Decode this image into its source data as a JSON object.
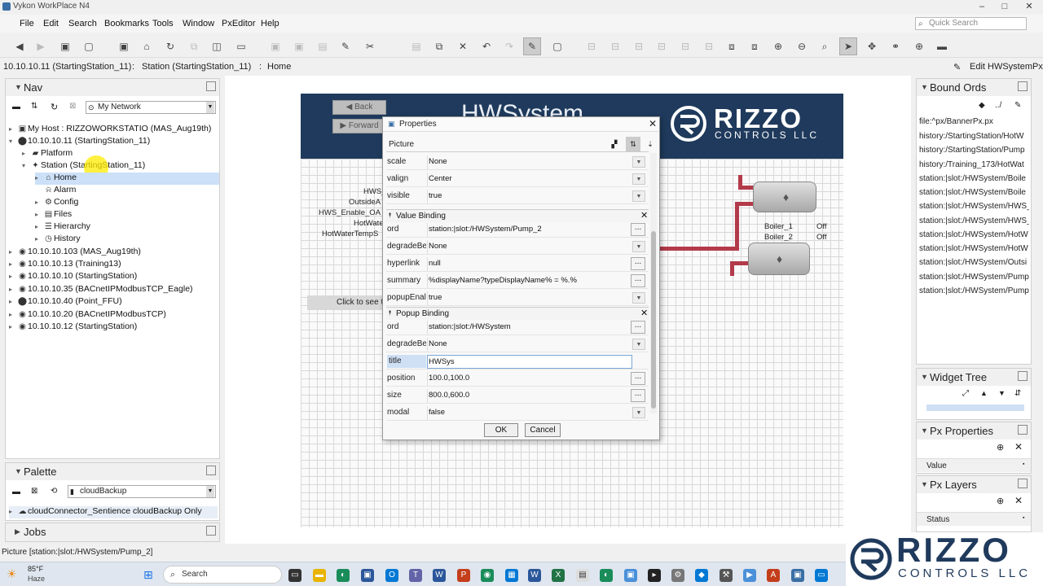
{
  "window": {
    "title": "Vykon WorkPlace N4",
    "minimize": "–",
    "maximize": "□",
    "close": "✕"
  },
  "menu": [
    "File",
    "Edit",
    "Search",
    "Bookmarks",
    "Tools",
    "Window",
    "PxEditor",
    "Help"
  ],
  "quick_search": {
    "placeholder": "Quick Search"
  },
  "breadcrumb": [
    "10.10.10.11 (StartingStation_11)",
    "Station (StartingStation_11)",
    "Home"
  ],
  "edit_label": "Edit HWSystemPx",
  "nav": {
    "title": "Nav",
    "network_select": "My Network",
    "tree": [
      {
        "label": "My Host : RIZZOWORKSTATIO (MAS_Aug19th)"
      },
      {
        "label": "10.10.10.11 (StartingStation_11)"
      },
      {
        "label": "Platform"
      },
      {
        "label": "Station (StartingStation_11)"
      },
      {
        "label": "Home"
      },
      {
        "label": "Alarm"
      },
      {
        "label": "Config"
      },
      {
        "label": "Files"
      },
      {
        "label": "Hierarchy"
      },
      {
        "label": "History"
      },
      {
        "label": "10.10.10.103 (MAS_Aug19th)"
      },
      {
        "label": "10.10.10.13 (Training13)"
      },
      {
        "label": "10.10.10.10 (StartingStation)"
      },
      {
        "label": "10.10.10.35 (BACnetIPModbusTCP_Eagle)"
      },
      {
        "label": "10.10.10.40 (Point_FFU)"
      },
      {
        "label": "10.10.10.20 (BACnetIPModbusTCP)"
      },
      {
        "label": "10.10.10.12 (StartingStation)"
      }
    ]
  },
  "palette": {
    "title": "Palette",
    "select": "cloudBackup",
    "item": "cloudConnector_Sentience cloudBackup Only"
  },
  "jobs": {
    "title": "Jobs"
  },
  "status_bar": "Picture [station:|slot:/HWSystem/Pump_2]",
  "canvas": {
    "header_title": "HWSystem",
    "back": "Back",
    "forward": "Forward",
    "logo_main": "RIZZO",
    "logo_sub": "CONTROLS LLC",
    "labels": [
      "HWS_",
      "OutsideA",
      "HWS_Enable_OA",
      "HotWate",
      "HotWaterTempS"
    ],
    "click_label": "Click to see t",
    "boiler_1": "Boiler_1",
    "boiler_2": "Boiler_2",
    "boiler_1_state": "Off",
    "boiler_2_state": "Off"
  },
  "dialog": {
    "title": "Properties",
    "tab": "Picture",
    "rows_top": [
      {
        "name": "scale",
        "value": "None"
      },
      {
        "name": "valign",
        "value": "Center"
      },
      {
        "name": "visible",
        "value": "true"
      }
    ],
    "value_binding": {
      "title": "Value Binding",
      "rows": [
        {
          "name": "ord",
          "value": "station:|slot:/HWSystem/Pump_2"
        },
        {
          "name": "degradeBe",
          "value": "None"
        },
        {
          "name": "hyperlink",
          "value": "null"
        },
        {
          "name": "summary",
          "value": "%displayName?typeDisplayName% = %.%"
        },
        {
          "name": "popupEnal",
          "value": "true"
        }
      ]
    },
    "popup_binding": {
      "title": "Popup Binding",
      "rows": [
        {
          "name": "ord",
          "value": "station:|slot:/HWSystem"
        },
        {
          "name": "degradeBe",
          "value": "None"
        },
        {
          "name": "title",
          "value": "HWSys"
        },
        {
          "name": "position",
          "value": "100.0,100.0"
        },
        {
          "name": "size",
          "value": "800.0,600.0"
        },
        {
          "name": "modal",
          "value": "false"
        }
      ]
    },
    "ok": "OK",
    "cancel": "Cancel",
    "dots": "..."
  },
  "bound_ords": {
    "title": "Bound Ords",
    "items": [
      "file:^px/BannerPx.px",
      "history:/StartingStation/HotW",
      "history:/StartingStation/Pump",
      "history:/Training_173/HotWat",
      "station:|slot:/HWSystem/Boile",
      "station:|slot:/HWSystem/Boile",
      "station:|slot:/HWSystem/HWS_",
      "station:|slot:/HWSystem/HWS_",
      "station:|slot:/HWSystem/HotW",
      "station:|slot:/HWSystem/HotW",
      "station:|slot:/HWSystem/Outsi",
      "station:|slot:/HWSystem/Pump",
      "station:|slot:/HWSystem/Pump"
    ]
  },
  "widget_tree": {
    "title": "Widget Tree"
  },
  "px_properties": {
    "title": "Px Properties",
    "value_label": "Value"
  },
  "px_layers": {
    "title": "Px Layers",
    "status_label": "Status"
  },
  "taskbar": {
    "temp": "85°F",
    "weather": "Haze",
    "search": "Search"
  },
  "overlay_logo": {
    "main": "RIZZO",
    "sub": "CONTROLS LLC"
  }
}
